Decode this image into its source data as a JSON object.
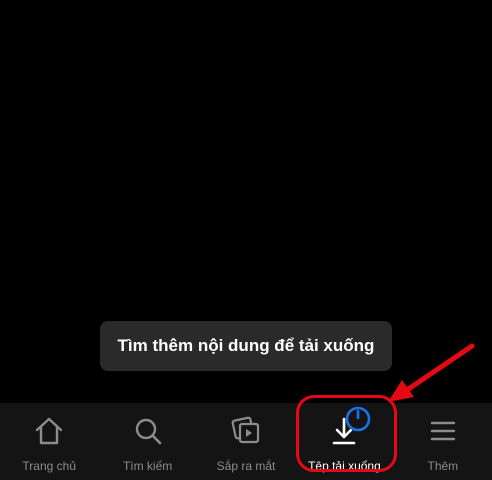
{
  "toast": {
    "message": "Tìm thêm nội dung để tải xuống"
  },
  "nav": {
    "items": [
      {
        "label": "Trang chủ",
        "icon": "home-icon",
        "active": false
      },
      {
        "label": "Tìm kiếm",
        "icon": "search-icon",
        "active": false
      },
      {
        "label": "Sắp ra mắt",
        "icon": "coming-soon-icon",
        "active": false
      },
      {
        "label": "Tệp tải xuống",
        "icon": "download-icon",
        "active": true
      },
      {
        "label": "Thêm",
        "icon": "menu-icon",
        "active": false
      }
    ]
  },
  "colors": {
    "background": "#000000",
    "navbar": "#141414",
    "toast": "#2a2a2a",
    "inactive": "#8c8c8c",
    "active": "#ffffff",
    "annotation": "#e50914",
    "badge": "#1a73e8"
  }
}
